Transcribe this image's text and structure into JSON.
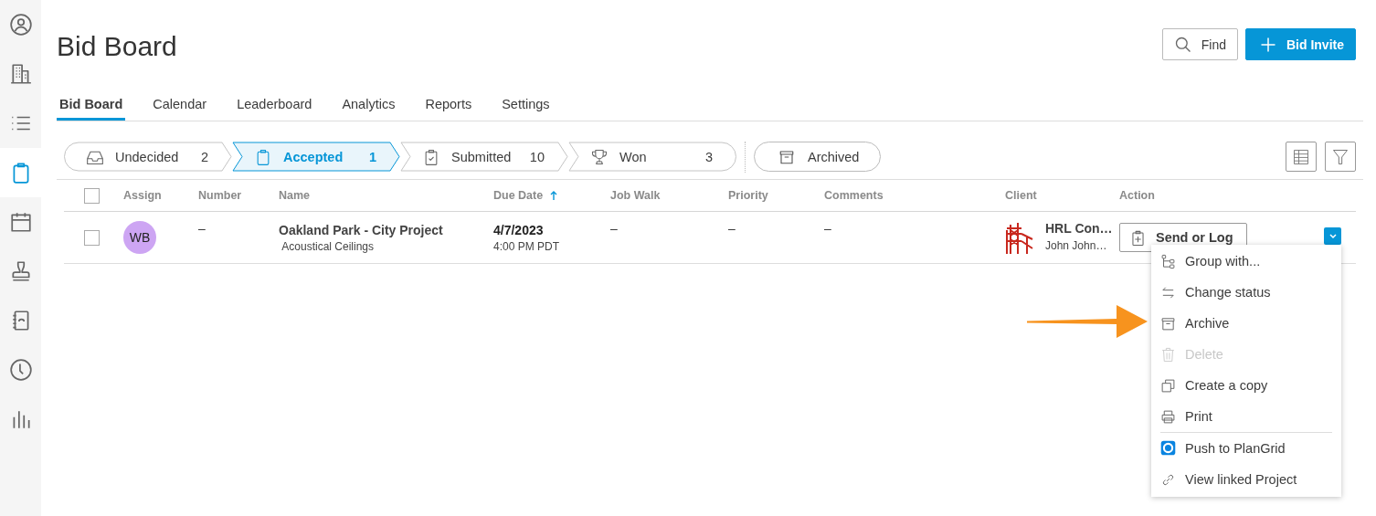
{
  "sidebar": {
    "items": [
      {
        "kind": "person",
        "selected": false
      },
      {
        "kind": "building",
        "selected": false
      },
      {
        "kind": "list",
        "selected": false
      },
      {
        "kind": "clipboard",
        "selected": true
      },
      {
        "kind": "calendar",
        "selected": false
      },
      {
        "kind": "stamp",
        "selected": false
      },
      {
        "kind": "contacts",
        "selected": false
      },
      {
        "kind": "clock",
        "selected": false
      },
      {
        "kind": "chart",
        "selected": false
      }
    ]
  },
  "header": {
    "title": "Bid Board",
    "find_button": {
      "label": "Find"
    },
    "invite_button": {
      "label": "Bid Invite"
    }
  },
  "tabs": [
    {
      "label": "Bid Board",
      "selected": true
    },
    {
      "label": "Calendar",
      "selected": false
    },
    {
      "label": "Leaderboard",
      "selected": false
    },
    {
      "label": "Analytics",
      "selected": false
    },
    {
      "label": "Reports",
      "selected": false
    },
    {
      "label": "Settings",
      "selected": false
    }
  ],
  "stages": [
    {
      "kind": "inbox",
      "label": "Undecided",
      "count": "2",
      "selected": false
    },
    {
      "kind": "clipboard",
      "label": "Accepted",
      "count": "1",
      "selected": true
    },
    {
      "kind": "clipboard-check",
      "label": "Submitted",
      "count": "10",
      "selected": false
    },
    {
      "kind": "trophy",
      "label": "Won",
      "count": "3",
      "selected": false
    }
  ],
  "archived_button": {
    "label": "Archived"
  },
  "table": {
    "select_all": {
      "checked": false
    },
    "columns": [
      {
        "label": "Assign",
        "sorted": false
      },
      {
        "label": "Number",
        "sorted": false
      },
      {
        "label": "Name",
        "sorted": false
      },
      {
        "label": "Due Date",
        "sorted": true
      },
      {
        "label": "Job Walk",
        "sorted": false
      },
      {
        "label": "Priority",
        "sorted": false
      },
      {
        "label": "Comments",
        "sorted": false
      },
      {
        "label": "Client",
        "sorted": false
      },
      {
        "label": "Action",
        "sorted": false
      }
    ],
    "rows": [
      {
        "checked": false,
        "assignee": {
          "initials": "WB",
          "color": "#cda5f3"
        },
        "number": "–",
        "name": "Oakland Park - City Project",
        "trade": "Acoustical Ceilings",
        "due_date": "4/7/2023",
        "due_time": "4:00 PM PDT",
        "job_walk": "–",
        "priority": "–",
        "comments": "–",
        "client": "HRL Con…",
        "contact": "John John…",
        "action": "Send or Log"
      }
    ]
  },
  "menu": {
    "items": [
      {
        "kind": "group",
        "label": "Group with...",
        "disabled": false,
        "divider_before": false
      },
      {
        "kind": "swap",
        "label": "Change status",
        "disabled": false,
        "divider_before": false
      },
      {
        "kind": "archive",
        "label": "Archive",
        "disabled": false,
        "divider_before": false
      },
      {
        "kind": "trash",
        "label": "Delete",
        "disabled": true,
        "divider_before": false
      },
      {
        "kind": "copy",
        "label": "Create a copy",
        "disabled": false,
        "divider_before": false
      },
      {
        "kind": "print",
        "label": "Print",
        "disabled": false,
        "divider_before": false
      },
      {
        "kind": "ring",
        "label": "Push to PlanGrid",
        "disabled": false,
        "divider_before": true
      },
      {
        "kind": "link",
        "label": "View linked Project",
        "disabled": false,
        "divider_before": false
      }
    ]
  }
}
